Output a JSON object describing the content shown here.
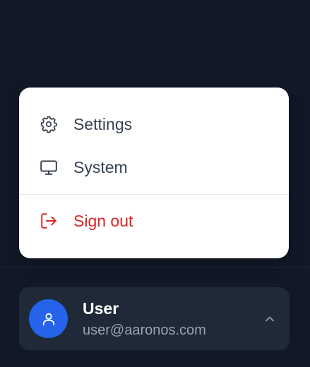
{
  "menu": {
    "items": [
      {
        "label": "Settings",
        "icon": "gear-icon"
      },
      {
        "label": "System",
        "icon": "monitor-icon"
      },
      {
        "label": "Sign out",
        "icon": "sign-out-icon"
      }
    ]
  },
  "user": {
    "name": "User",
    "email": "user@aaronos.com",
    "avatar_icon": "user-icon",
    "toggle_icon": "chevron-up-icon"
  },
  "colors": {
    "background": "#111827",
    "menu_background": "#ffffff",
    "danger": "#dc2626",
    "avatar": "#2563eb",
    "card": "#1f2937"
  }
}
